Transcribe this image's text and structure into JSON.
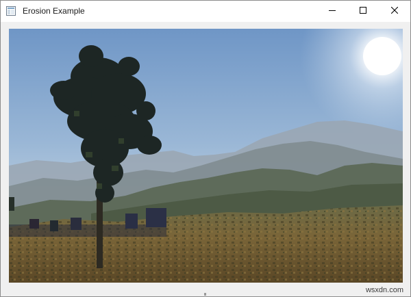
{
  "window": {
    "title": "Erosion Example",
    "icon": "app-window-icon"
  },
  "titlebar": {
    "minimize_icon": "minimize-icon",
    "maximize_icon": "maximize-icon",
    "close_icon": "close-icon"
  },
  "image": {
    "content": "eroded landscape photo: tree silhouette, hills, sun",
    "colors": {
      "sky_top": "#7fa3cf",
      "sky_horizon": "#c8d6e2",
      "sun": "#ffffff",
      "hills_far": "#8a96a3",
      "hills_mid": "#5f6a5c",
      "ground": "#6e5a33",
      "tree": "#1c2624"
    }
  },
  "watermark": {
    "text": "wsxdn.com"
  }
}
